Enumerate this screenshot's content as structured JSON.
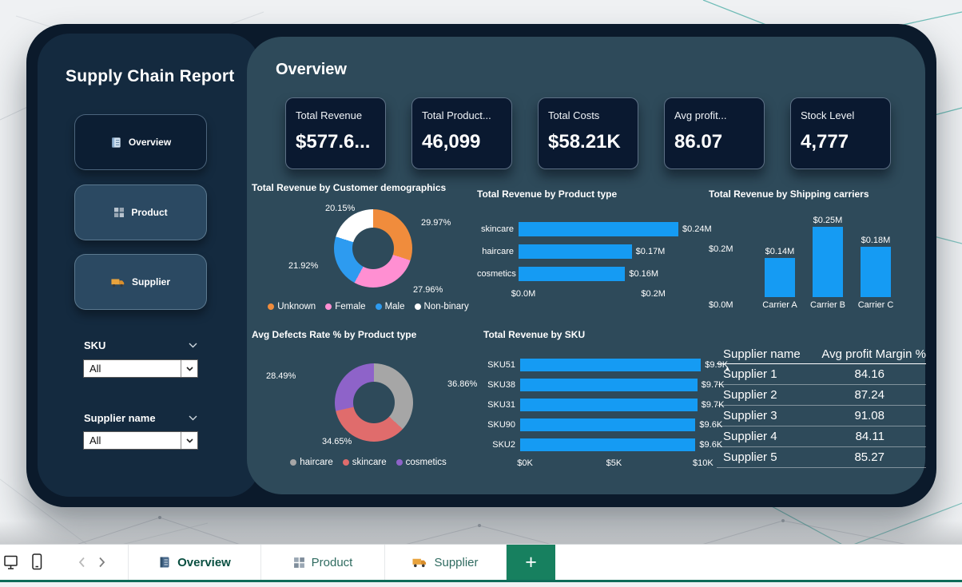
{
  "report": {
    "title": "Supply Chain Report",
    "page_title": "Overview"
  },
  "colors": {
    "bar_blue": "#159BF3",
    "tab_green": "#17805F"
  },
  "sidebar": {
    "nav": [
      {
        "label": "Overview"
      },
      {
        "label": "Product"
      },
      {
        "label": "Supplier"
      }
    ],
    "filters": [
      {
        "label": "SKU",
        "value": "All"
      },
      {
        "label": "Supplier name",
        "value": "All"
      }
    ]
  },
  "kpis": [
    {
      "label": "Total Revenue",
      "value": "$577.6..."
    },
    {
      "label": "Total Product...",
      "value": "46,099"
    },
    {
      "label": "Total Costs",
      "value": "$58.21K"
    },
    {
      "label": "Avg profit...",
      "value": "86.07"
    },
    {
      "label": "Stock Level",
      "value": "4,777"
    }
  ],
  "chart_data": [
    {
      "type": "pie",
      "donut": true,
      "title": "Total Revenue by Customer demographics",
      "labels": [
        "Unknown",
        "Female",
        "Male",
        "Non-binary"
      ],
      "values": [
        29.97,
        27.96,
        21.92,
        20.15
      ],
      "pct_labels": [
        "29.97%",
        "27.96%",
        "21.92%",
        "20.15%"
      ],
      "colors": [
        "#F08C3C",
        "#FF8FD2",
        "#2D9BF0",
        "#FFFFFF"
      ],
      "legend_position": "bottom"
    },
    {
      "type": "bar",
      "orientation": "horizontal",
      "title": "Total Revenue by Product type",
      "categories": [
        "skincare",
        "haircare",
        "cosmetics"
      ],
      "values": [
        0.24,
        0.17,
        0.16
      ],
      "value_labels": [
        "$0.24M",
        "$0.17M",
        "$0.16M"
      ],
      "x_ticks": [
        {
          "label": "$0.0M",
          "value": 0
        },
        {
          "label": "$0.2M",
          "value": 0.2
        }
      ],
      "xlim": [
        0,
        0.3
      ]
    },
    {
      "type": "bar",
      "orientation": "vertical",
      "title": "Total Revenue by Shipping carriers",
      "categories": [
        "Carrier A",
        "Carrier B",
        "Carrier C"
      ],
      "values": [
        0.14,
        0.25,
        0.18
      ],
      "value_labels": [
        "$0.14M",
        "$0.25M",
        "$0.18M"
      ],
      "y_ticks": [
        {
          "label": "$0.2M",
          "value": 0.2
        },
        {
          "label": "$0.0M",
          "value": 0
        }
      ],
      "ylim": [
        0,
        0.27
      ]
    },
    {
      "type": "pie",
      "donut": true,
      "title": "Avg Defects Rate % by Product type",
      "labels": [
        "haircare",
        "skincare",
        "cosmetics"
      ],
      "values": [
        36.86,
        34.65,
        28.49
      ],
      "pct_labels": [
        "36.86%",
        "34.65%",
        "28.49%"
      ],
      "colors": [
        "#A6A6A6",
        "#E06C6C",
        "#8E63C9"
      ],
      "legend_position": "bottom"
    },
    {
      "type": "bar",
      "orientation": "horizontal",
      "title": "Total Revenue by SKU",
      "categories": [
        "SKU51",
        "SKU38",
        "SKU31",
        "SKU90",
        "SKU2"
      ],
      "values": [
        9.9,
        9.7,
        9.7,
        9.6,
        9.6
      ],
      "value_labels": [
        "$9.9K",
        "$9.7K",
        "$9.7K",
        "$9.6K",
        "$9.6K"
      ],
      "x_ticks": [
        {
          "label": "$0K",
          "value": 0
        },
        {
          "label": "$5K",
          "value": 5
        },
        {
          "label": "$10K",
          "value": 10
        }
      ],
      "xlim": [
        0,
        10.5
      ]
    },
    {
      "type": "table",
      "columns": [
        "Supplier name",
        "Avg profit Margin %"
      ],
      "rows": [
        [
          "Supplier 1",
          "84.16"
        ],
        [
          "Supplier 2",
          "87.24"
        ],
        [
          "Supplier 3",
          "91.08"
        ],
        [
          "Supplier 4",
          "84.11"
        ],
        [
          "Supplier 5",
          "85.27"
        ]
      ]
    }
  ],
  "footer": {
    "tabs": [
      {
        "label": "Overview",
        "active": true
      },
      {
        "label": "Product",
        "active": false
      },
      {
        "label": "Supplier",
        "active": false
      }
    ],
    "add_label": "+"
  }
}
